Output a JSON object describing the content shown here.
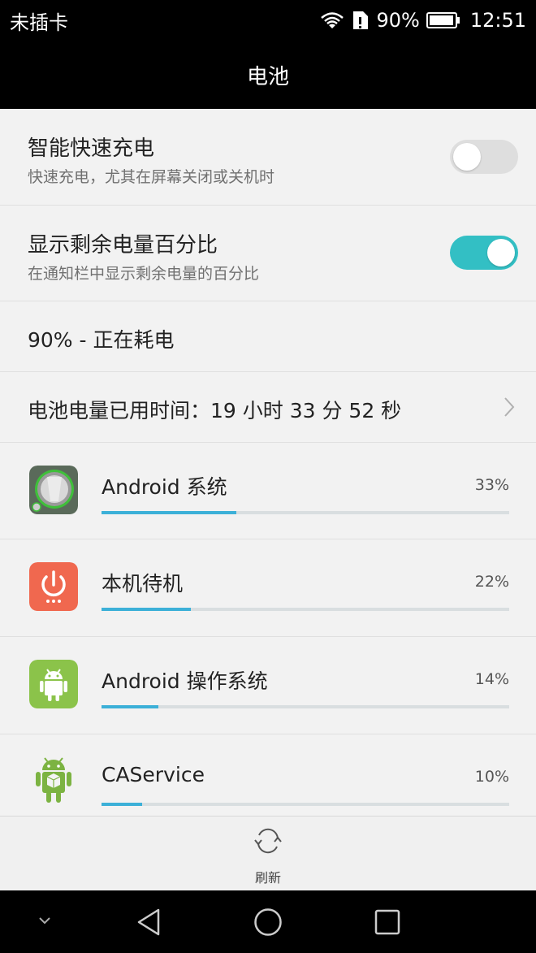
{
  "status_bar": {
    "carrier": "未插卡",
    "battery_percent": "90%",
    "time": "12:51"
  },
  "title": "电池",
  "settings": [
    {
      "title": "智能快速充电",
      "subtitle": "快速充电，尤其在屏幕关闭或关机时",
      "enabled": false
    },
    {
      "title": "显示剩余电量百分比",
      "subtitle": "在通知栏中显示剩余电量的百分比",
      "enabled": true
    }
  ],
  "battery_status": "90% - 正在耗电",
  "usage_time": "电池电量已用时间：19 小时 33 分 52 秒",
  "apps": [
    {
      "name": "Android 系统",
      "percent": "33%",
      "fraction": 0.33,
      "icon": "android-system-icon"
    },
    {
      "name": "本机待机",
      "percent": "22%",
      "fraction": 0.22,
      "icon": "power-standby-icon"
    },
    {
      "name": "Android 操作系统",
      "percent": "14%",
      "fraction": 0.14,
      "icon": "android-os-icon"
    },
    {
      "name": "CAService",
      "percent": "10%",
      "fraction": 0.1,
      "icon": "caservice-icon"
    }
  ],
  "refresh_label": "刷新",
  "colors": {
    "accent": "#33bfc4",
    "bar_fill": "#3cb0d8",
    "standby_icon_bg": "#f0684f",
    "android_green": "#8bc34a"
  }
}
